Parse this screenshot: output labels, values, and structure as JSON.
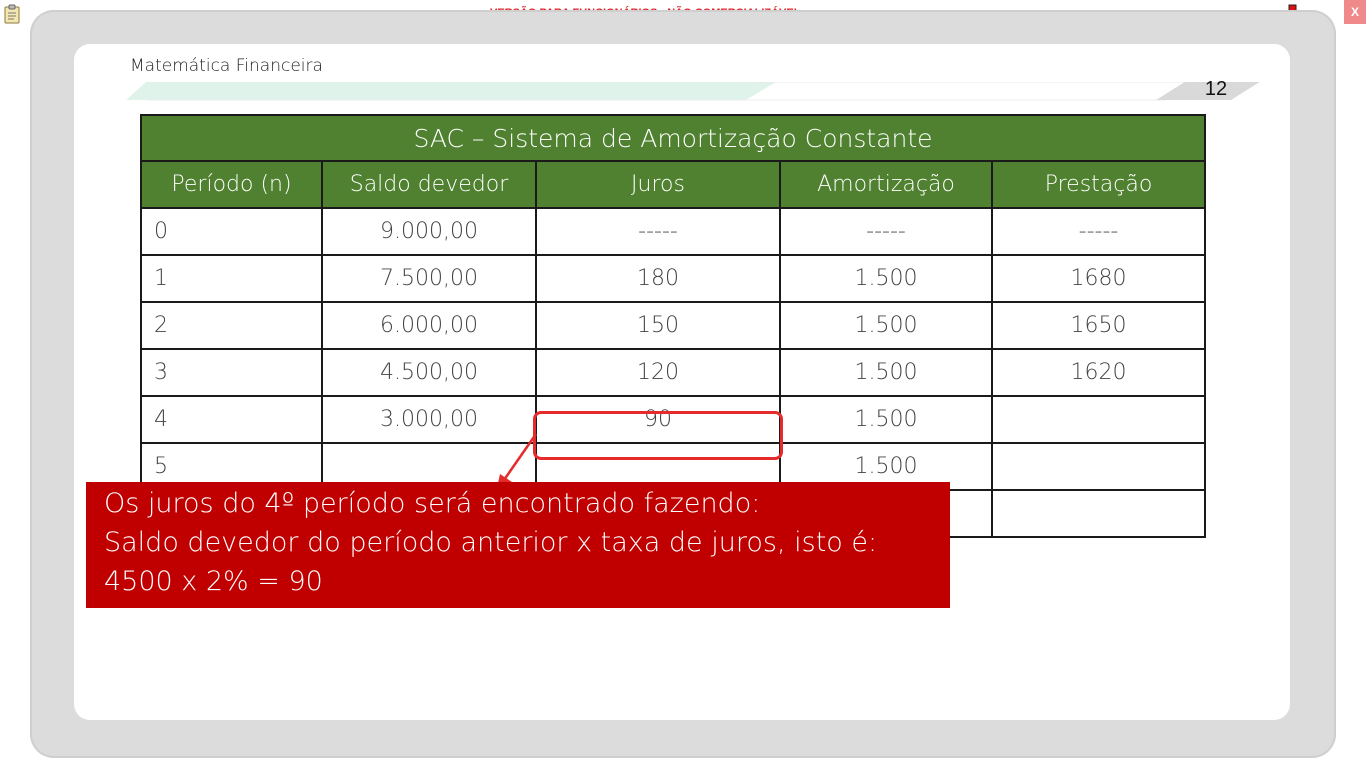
{
  "topbar": {
    "watermark": "VERSÃO PARA FUNCIONÁRIOS - NÃO COMERCIALIZÁVEL",
    "close_label": "X"
  },
  "slide": {
    "subject": "Matemática Financeira",
    "page_number": "12",
    "table": {
      "title": "SAC – Sistema de Amortização Constante",
      "headers": [
        "Período (n)",
        "Saldo devedor",
        "Juros",
        "Amortização",
        "Prestação"
      ],
      "rows": [
        [
          "0",
          "9.000,00",
          "-----",
          "-----",
          "-----"
        ],
        [
          "1",
          "7.500,00",
          "180",
          "1.500",
          "1680"
        ],
        [
          "2",
          "6.000,00",
          "150",
          "1.500",
          "1650"
        ],
        [
          "3",
          "4.500,00",
          "120",
          "1.500",
          "1620"
        ],
        [
          "4",
          "3.000,00",
          "90",
          "1.500",
          ""
        ],
        [
          "5",
          "",
          "",
          "1.500",
          ""
        ],
        [
          "",
          "",
          "",
          "",
          ""
        ]
      ]
    },
    "callout": {
      "line1": "Os juros do 4º período será encontrado fazendo:",
      "line2": "Saldo devedor do período anterior x taxa de juros, isto é:",
      "line3": "4500 x 2% = 90"
    }
  },
  "colors": {
    "header_green": "#4f8130",
    "callout_red": "#c00000",
    "highlight_red": "#e52b2b",
    "watermark_red": "#e0242a"
  },
  "icons": [
    "clipboard-icon",
    "network-icon",
    "close-icon"
  ]
}
